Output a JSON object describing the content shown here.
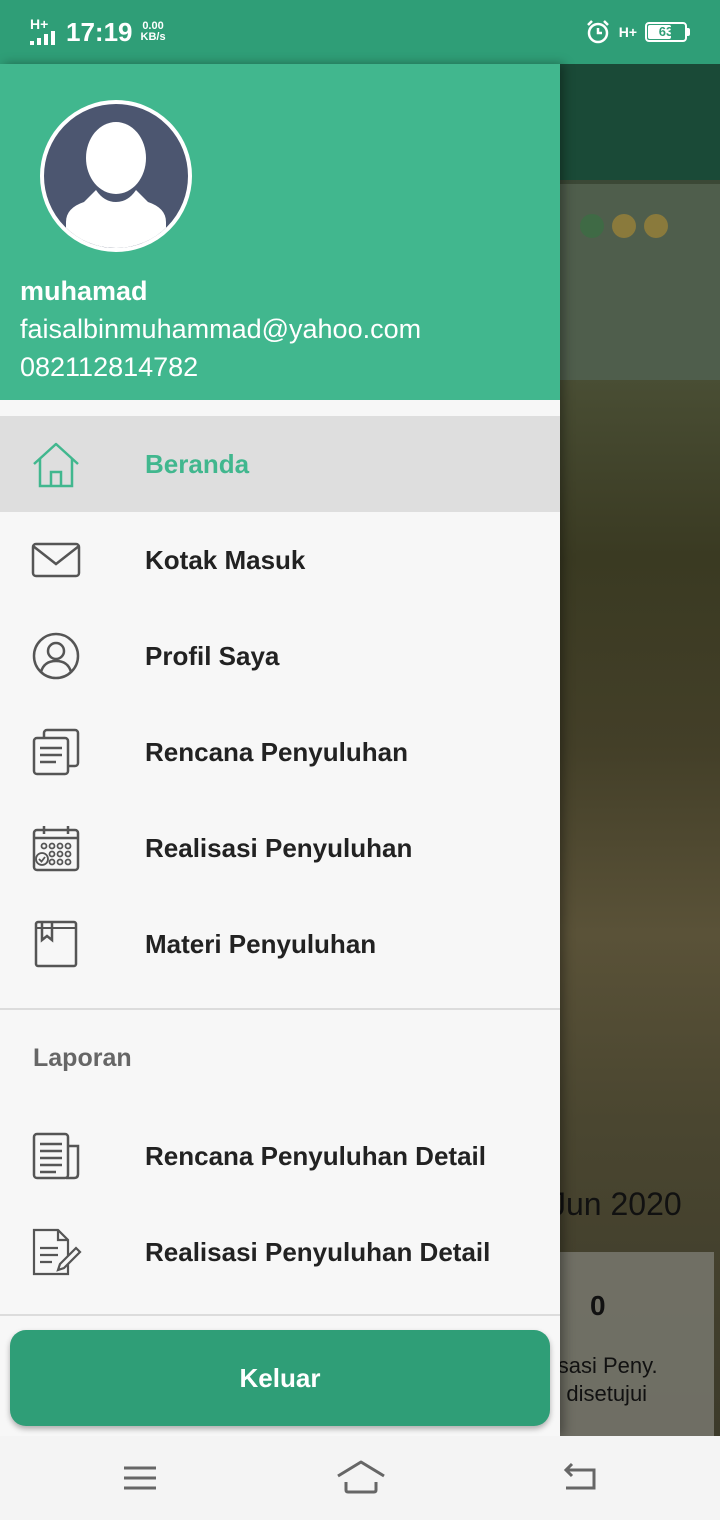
{
  "status_bar": {
    "network_left": "H+",
    "time": "17:19",
    "speed_value": "0.00",
    "speed_unit": "KB/s",
    "network_right": "H+",
    "battery": "63"
  },
  "profile": {
    "name": "muhamad",
    "email": "faisalbinmuhammad@yahoo.com",
    "phone": "082112814782"
  },
  "menu": {
    "items": [
      {
        "label": "Beranda",
        "icon": "home-icon",
        "active": true
      },
      {
        "label": "Kotak Masuk",
        "icon": "mail-icon"
      },
      {
        "label": "Profil Saya",
        "icon": "user-circle-icon"
      },
      {
        "label": "Rencana Penyuluhan",
        "icon": "documents-icon"
      },
      {
        "label": "Realisasi Penyuluhan",
        "icon": "calendar-icon"
      },
      {
        "label": "Materi Penyuluhan",
        "icon": "book-icon"
      }
    ],
    "section_title": "Laporan",
    "report_items": [
      {
        "label": "Rencana Penyuluhan Detail",
        "icon": "report-icon"
      },
      {
        "label": "Realisasi Penyuluhan Detail",
        "icon": "edit-document-icon"
      }
    ],
    "logout_label": "Keluar"
  },
  "background": {
    "date_fragment": "Jun 2020",
    "count": "0",
    "card_line1": "lisasi Peny.",
    "card_line2": "g disetujui"
  },
  "colors": {
    "primary": "#41b78e",
    "primary_dark": "#2f9e77"
  }
}
